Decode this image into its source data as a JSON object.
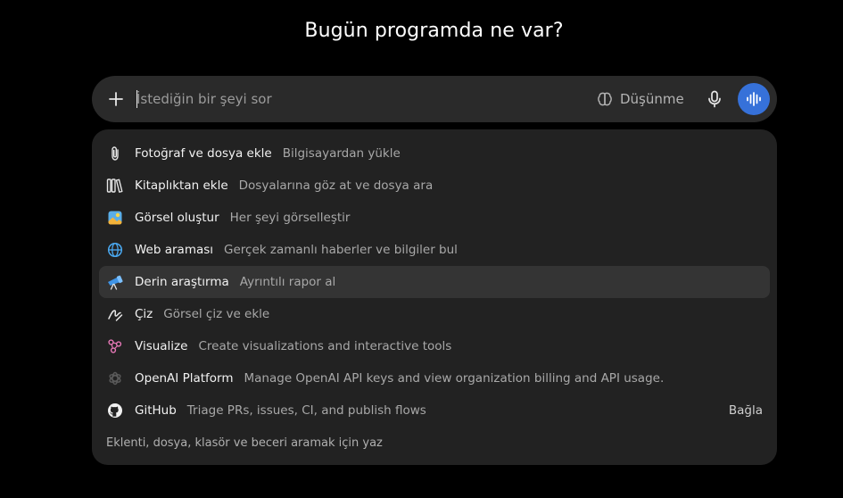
{
  "headline": "Bugün programda ne var?",
  "composer": {
    "placeholder": "İstediğin bir şeyi sor",
    "thinking_label": "Düşünme"
  },
  "menu": {
    "items": [
      {
        "label": "Fotoğraf ve dosya ekle",
        "desc": "Bilgisayardan yükle",
        "icon": "paperclip-icon"
      },
      {
        "label": "Kitaplıktan ekle",
        "desc": "Dosyalarına göz at ve dosya ara",
        "icon": "library-icon"
      },
      {
        "label": "Görsel oluştur",
        "desc": "Her şeyi görselleştir",
        "icon": "image-icon"
      },
      {
        "label": "Web araması",
        "desc": "Gerçek zamanlı haberler ve bilgiler bul",
        "icon": "globe-icon"
      },
      {
        "label": "Derin araştırma",
        "desc": "Ayrıntılı rapor al",
        "icon": "telescope-icon"
      },
      {
        "label": "Çiz",
        "desc": "Görsel çiz ve ekle",
        "icon": "draw-icon"
      },
      {
        "label": "Visualize",
        "desc": "Create visualizations and interactive tools",
        "icon": "visualize-icon"
      },
      {
        "label": "OpenAI Platform",
        "desc": "Manage OpenAI API keys and view organization billing and API usage.",
        "icon": "openai-icon"
      },
      {
        "label": "GitHub",
        "desc": "Triage PRs, issues, CI, and publish flows",
        "icon": "github-icon",
        "action": "Bağla"
      }
    ],
    "footer_hint": "Eklenti, dosya, klasör ve beceri aramak için yaz"
  },
  "colors": {
    "background": "#000000",
    "composer_bg": "#2a2a2a",
    "menu_bg": "#222222",
    "active_row": "#343434",
    "voice_button": "#3671d9"
  }
}
